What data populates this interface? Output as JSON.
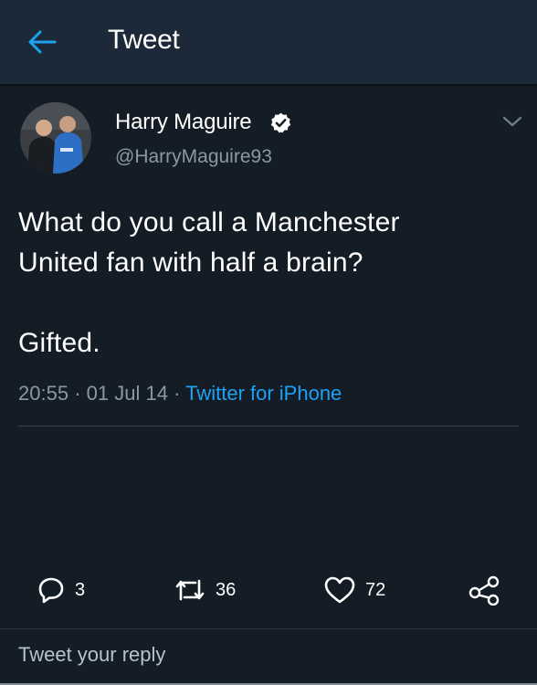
{
  "header": {
    "title": "Tweet",
    "back_icon": "back-arrow-icon",
    "accent_color": "#1da1f2"
  },
  "tweet": {
    "author_name": "Harry Maguire",
    "handle": "@HarryMaguire93",
    "verified": true,
    "text_lines": [
      "What do you call a Manchester",
      "United fan with half a brain?",
      "Gifted."
    ],
    "time": "20:55",
    "date": "01 Jul 14",
    "separator": "·",
    "source": "Twitter for iPhone"
  },
  "actions": {
    "reply": {
      "icon": "reply-icon",
      "count": "3"
    },
    "retweet": {
      "icon": "retweet-icon",
      "count": "36"
    },
    "like": {
      "icon": "heart-icon",
      "count": "72"
    },
    "share": {
      "icon": "share-icon"
    }
  },
  "reply_box": {
    "placeholder": "Tweet your reply"
  }
}
